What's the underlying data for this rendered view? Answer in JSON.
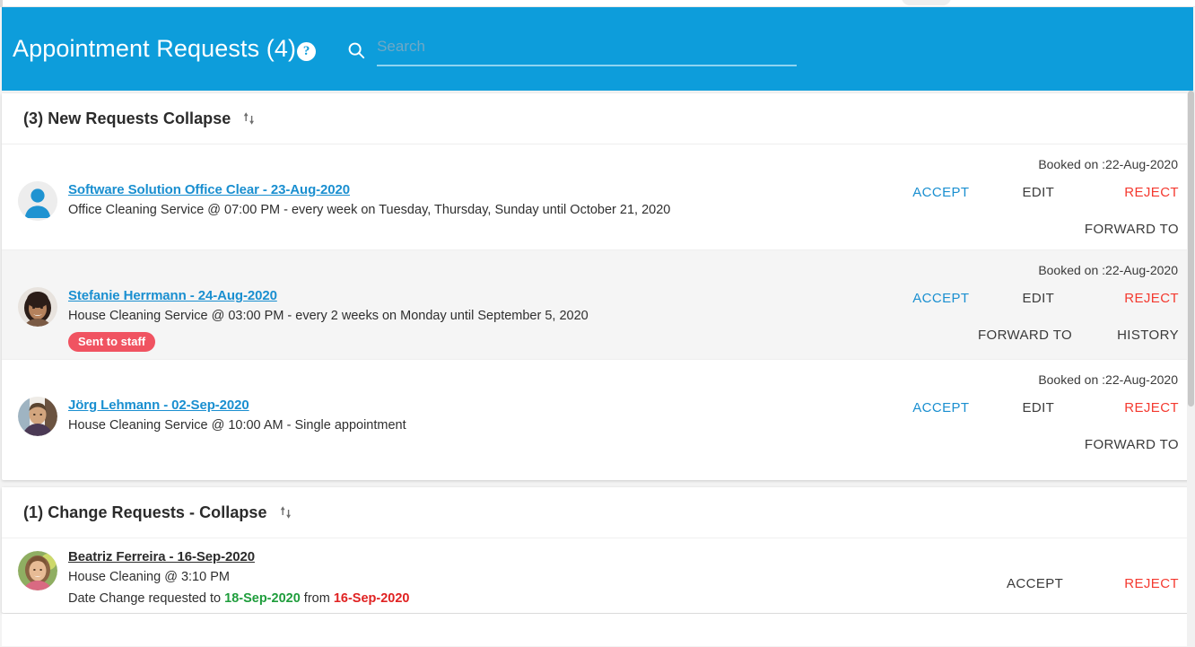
{
  "header": {
    "title": "Appointment Requests (4)",
    "help_icon": "question-mark-icon",
    "search_icon": "search-icon",
    "search_placeholder": "Search",
    "search_value": "",
    "accent_color": "#0d9ddb"
  },
  "sections": [
    {
      "id": "new-requests",
      "title": "(3) New Requests Collapse",
      "sort_icon": "sort-arrows-icon"
    },
    {
      "id": "change-requests",
      "title": "(1) Change Requests - Collapse",
      "sort_icon": "sort-arrows-icon"
    }
  ],
  "labels": {
    "accept": "ACCEPT",
    "edit": "EDIT",
    "reject": "REJECT",
    "forward_to": "FORWARD TO",
    "history": "HISTORY"
  },
  "colors": {
    "accept": "#1a8fd0",
    "reject": "#f4392f",
    "neutral": "#3a3a3a",
    "badge": "#f05361",
    "date_new": "#1f9d3c",
    "date_old": "#e02222"
  },
  "new_requests": [
    {
      "avatar": "default-person-avatar",
      "title": "Software Solution Office Clear - 23-Aug-2020",
      "subtitle": "Office Cleaning Service @ 07:00 PM - every week on Tuesday, Thursday, Sunday until October 21, 2020",
      "badge": null,
      "booked_on": "Booked on :22-Aug-2020",
      "has_history": false
    },
    {
      "avatar": "photo-avatar-woman",
      "title": "Stefanie Herrmann - 24-Aug-2020",
      "subtitle": "House Cleaning Service @ 03:00 PM - every 2 weeks on Monday until September 5, 2020",
      "badge": "Sent to staff",
      "booked_on": "Booked on :22-Aug-2020",
      "has_history": true
    },
    {
      "avatar": "photo-avatar-man",
      "title": "Jörg Lehmann - 02-Sep-2020",
      "subtitle": "House Cleaning Service @ 10:00 AM - Single appointment",
      "badge": null,
      "booked_on": "Booked on :22-Aug-2020",
      "has_history": false
    }
  ],
  "change_requests": [
    {
      "avatar": "photo-avatar-woman-2",
      "name": "Beatriz  Ferreira",
      "date": " - 16-Sep-2020",
      "subtitle": "House Cleaning @ 3:10 PM",
      "change_prefix": "Date Change requested to ",
      "change_new_date": "18-Sep-2020",
      "change_mid": " from ",
      "change_old_date": "16-Sep-2020"
    }
  ]
}
